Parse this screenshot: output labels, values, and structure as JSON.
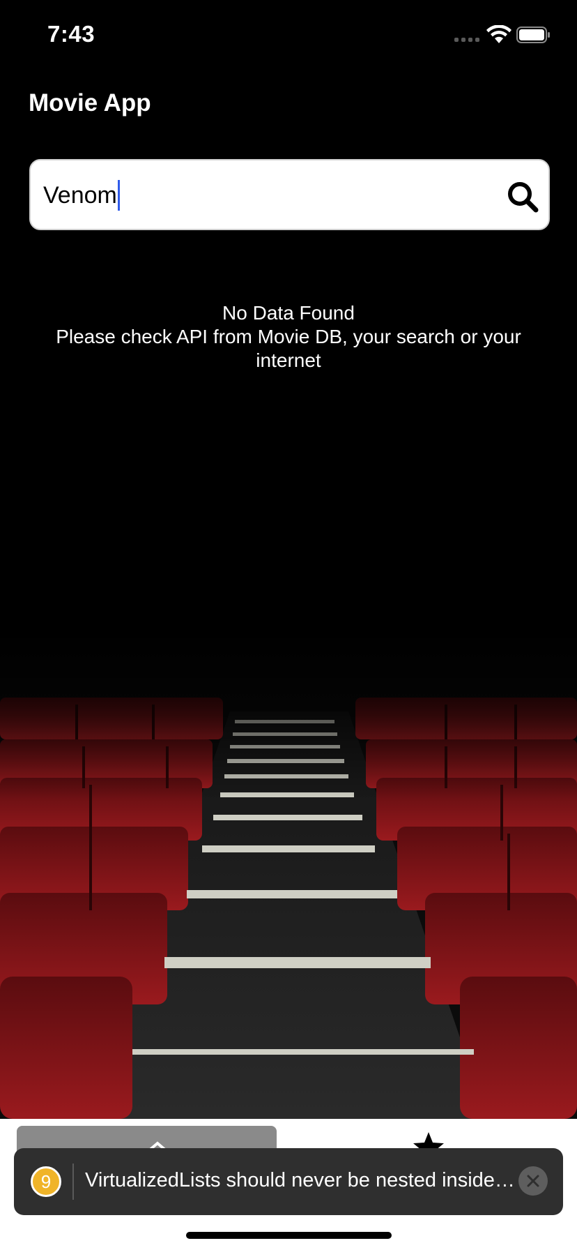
{
  "status_bar": {
    "time": "7:43"
  },
  "header": {
    "title": "Movie App"
  },
  "search": {
    "value": "Venom"
  },
  "empty_state": {
    "line1": "No Data Found",
    "line2": "Please check API from Movie DB, your search or your",
    "line3": "internet"
  },
  "toast": {
    "count": "9",
    "message": "VirtualizedLists should never be nested inside plain ScrollViews"
  },
  "tabs": [
    {
      "name": "home",
      "icon": "home-icon",
      "active": true
    },
    {
      "name": "favorites",
      "icon": "star-icon",
      "active": false
    }
  ],
  "colors": {
    "background": "#000000",
    "seat_red": "#8e1418",
    "caret": "#2f5bea",
    "toast_badge": "#f0b429",
    "toast_bg": "#2f2f2f"
  }
}
